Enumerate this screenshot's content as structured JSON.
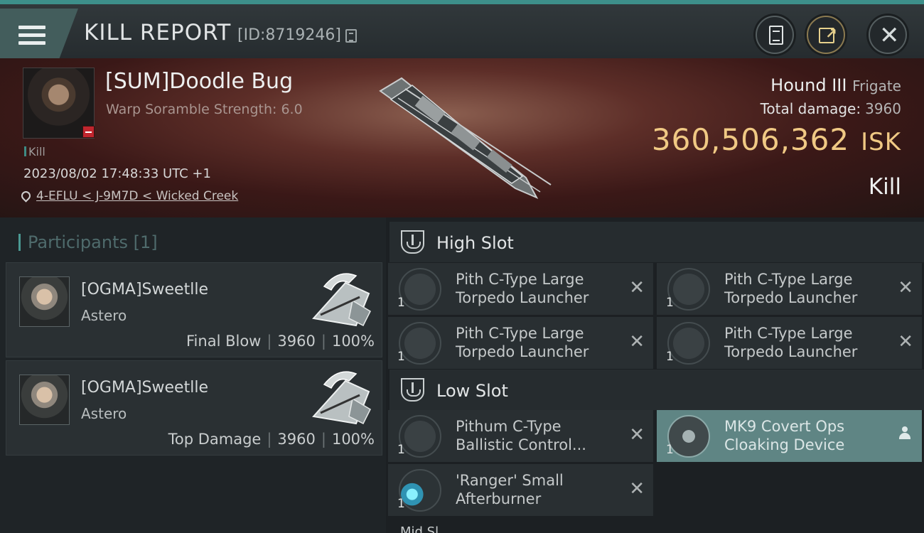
{
  "header": {
    "title": "KILL REPORT",
    "report_id": "[ID:8719246]",
    "menu_icon": "hamburger-menu-icon",
    "report_icon": "document-icon",
    "share_icon": "share-external-icon",
    "close_icon": "close-icon"
  },
  "victim": {
    "name": "[SUM]Doodle Bug",
    "scramble": "Warp Soramble Strength: 6.0",
    "kill_tag": "Kill",
    "datetime": "2023/08/02 17:48:33 UTC +1",
    "location": "4-EFLU < J-9M7D < Wicked Creek",
    "ship_name": "Hound III",
    "ship_class": "Frigate",
    "damage_label": "Total damage:",
    "damage_value": "3960",
    "isk_value": "360,506,362",
    "isk_unit": "ISK",
    "result": "Kill"
  },
  "participants": {
    "label": "Participants",
    "count": "[1]",
    "cards": [
      {
        "name": "[OGMA]Sweetlle",
        "ship": "Astero",
        "role": "Final Blow",
        "damage": "3960",
        "percent": "100%"
      },
      {
        "name": "[OGMA]Sweetlle",
        "ship": "Astero",
        "role": "Top Damage",
        "damage": "3960",
        "percent": "100%"
      }
    ]
  },
  "high_slot": {
    "title": "High Slot",
    "modules": [
      {
        "qty": "1",
        "line1": "Pith C-Type Large",
        "line2": "Torpedo Launcher"
      },
      {
        "qty": "1",
        "line1": "Pith C-Type Large",
        "line2": "Torpedo Launcher"
      },
      {
        "qty": "1",
        "line1": "Pith C-Type Large",
        "line2": "Torpedo Launcher"
      },
      {
        "qty": "1",
        "line1": "Pith C-Type Large",
        "line2": "Torpedo Launcher"
      }
    ]
  },
  "low_slot": {
    "title": "Low Slot",
    "modules": [
      {
        "qty": "1",
        "line1": "Pithum C-Type",
        "line2": "Ballistic Control..."
      },
      {
        "qty": "1",
        "line1": "MK9 Covert Ops",
        "line2": "Cloaking Device"
      },
      {
        "qty": "1",
        "line1": "'Ranger' Small",
        "line2": "Afterburner"
      }
    ]
  },
  "next_slot_peek": "Mid Sl",
  "colors": {
    "accent": "#3d8f8a",
    "isk": "#f0c984",
    "highlight": "#5f8584",
    "badge": "#c0262e"
  },
  "x_glyph": "✕"
}
